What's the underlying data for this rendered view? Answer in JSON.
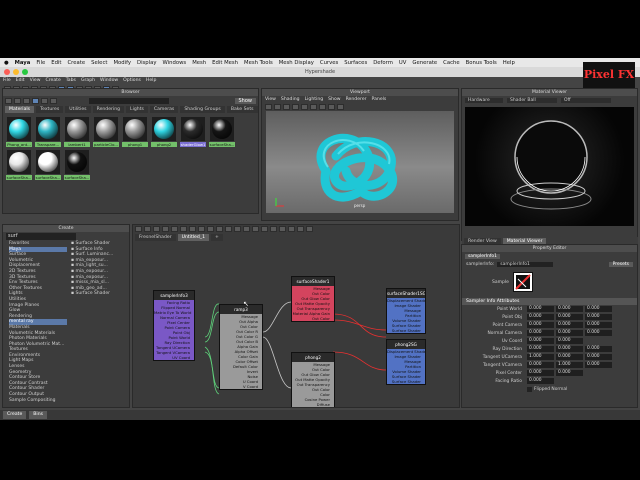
{
  "menubar": {
    "app_name": "Maya",
    "items": [
      "File",
      "Edit",
      "Create",
      "Select",
      "Modify",
      "Display",
      "Windows",
      "Mesh",
      "Edit Mesh",
      "Mesh Tools",
      "Mesh Display",
      "Curves",
      "Surfaces",
      "Deform",
      "UV",
      "Generate",
      "Cache",
      "Bonus Tools",
      "Help"
    ]
  },
  "window_title": "Hypershade",
  "hypershade_menu": [
    "File",
    "Edit",
    "View",
    "Create",
    "Tabs",
    "Graph",
    "Window",
    "Options",
    "Help"
  ],
  "browser": {
    "title": "Browser",
    "show_label": "Show",
    "tabs": [
      "Materials",
      "Textures",
      "Utilities",
      "Rendering",
      "Lights",
      "Cameras",
      "Shading Groups",
      "Bake Sets"
    ],
    "active_tab": "Materials",
    "swatches": [
      {
        "label": "Phong_ant...",
        "color": "#33d9e6"
      },
      {
        "label": "Transpare...",
        "color": "#2fb5c4"
      },
      {
        "label": "lambert1",
        "color": "#9b9b9b"
      },
      {
        "label": "particleClo...",
        "color": "#a0a0a0"
      },
      {
        "label": "phong1",
        "color": "#9a9a9a"
      },
      {
        "label": "phong2",
        "color": "#30d4e2"
      },
      {
        "label": "shaderGlow1",
        "color": "#2b2b2b",
        "selected": true
      },
      {
        "label": "surfaceSha...",
        "color": "#151515"
      },
      {
        "label": "surfaceSha...",
        "color": "#e8e8e8"
      },
      {
        "label": "surfaceSha...",
        "color": "#ffffff"
      },
      {
        "label": "surfaceSha...",
        "color": "#111111"
      }
    ]
  },
  "viewport": {
    "title": "Viewport",
    "menu": [
      "View",
      "Shading",
      "Lighting",
      "Show",
      "Renderer",
      "Panels"
    ],
    "camera_label": "persp"
  },
  "material_viewer": {
    "title": "Material Viewer",
    "dropdown1": "Hardware",
    "dropdown2": "Shader Ball",
    "dropdown3": "Off"
  },
  "create_panel": {
    "title": "Create",
    "search_value": "surf",
    "tree": [
      {
        "label": "Favorites"
      },
      {
        "label": "Maya",
        "hi": true
      },
      {
        "label": "Surface"
      },
      {
        "label": "Volumetric"
      },
      {
        "label": "Displacement"
      },
      {
        "label": "2D Textures"
      },
      {
        "label": "3D Textures"
      },
      {
        "label": "Env Textures"
      },
      {
        "label": "Other Textures"
      },
      {
        "label": "Lights"
      },
      {
        "label": "Utilities"
      },
      {
        "label": "Image Planes"
      },
      {
        "label": "Glow"
      },
      {
        "label": "Rendering"
      },
      {
        "label": "mental ray",
        "hi": true
      },
      {
        "label": "Materials"
      },
      {
        "label": "Volumetric Materials"
      },
      {
        "label": "Photon Materials"
      },
      {
        "label": "Photon Volumetric Mat..."
      },
      {
        "label": "Textures"
      },
      {
        "label": "Environments"
      },
      {
        "label": "Light Maps"
      },
      {
        "label": "Lenses"
      },
      {
        "label": "Geometry"
      },
      {
        "label": "Contour Store"
      },
      {
        "label": "Contour Contrast"
      },
      {
        "label": "Contour Shader"
      },
      {
        "label": "Contour Output"
      },
      {
        "label": "Sample Compositing"
      }
    ],
    "results": [
      "Surface Shader",
      "Surface Info",
      "Surf. Luminanc...",
      "mia_exposur...",
      "mia_light_su...",
      "mia_exposur...",
      "mia_exposur...",
      "misss_mia_sl...",
      "mib_geo_ad...",
      "Surface Shader"
    ]
  },
  "graph": {
    "tabs": [
      "FresnelShader",
      "Untitled_1",
      "+"
    ],
    "active_tab": "Untitled_1",
    "nodes": [
      {
        "name": "samplerInfo3",
        "color": "#7a58c6",
        "attrs": [
          "Facing Ratio",
          "Flipped Normal",
          "Matrix Eye To World",
          "Normal Camera",
          "Pixel Center",
          "Point Camera",
          "Point Obj",
          "Point World",
          "Ray Direction",
          "Tangent UCamera",
          "Tangent VCamera",
          "UV Coord"
        ]
      },
      {
        "name": "ramp3",
        "color": "#9a9a9a",
        "attrs": [
          "Message",
          "Out Alpha",
          "Out Color",
          "Out Color R",
          "Out Color G",
          "Out Color B",
          "Alpha Gain",
          "Alpha Offset",
          "Color Gain",
          "Color Offset",
          "Default Color",
          "Invert",
          "Noise",
          "U Coord",
          "V Coord"
        ]
      },
      {
        "name": "surfaceShader1",
        "color": "#d4445e",
        "attrs": [
          "Message",
          "Out Color",
          "Out Glow Color",
          "Out Matte Opacity",
          "Out Transparency",
          "Material Alpha Gain",
          "Out Color"
        ]
      },
      {
        "name": "phong2",
        "color": "#9a9a9a",
        "attrs": [
          "Message",
          "Out Color",
          "Out Glow Color",
          "Out Matte Opacity",
          "Out Transparency",
          "Out Color",
          "Color",
          "Cosine Power",
          "Diffuse",
          "Glow Intensity",
          "Incandescence",
          "Light Absorbance",
          "Material Alpha Gain"
        ]
      },
      {
        "name": "surfaceShader1SG",
        "color": "#5272c4",
        "attrs": [
          "Displacement Shader",
          "Image Shader",
          "Message",
          "Partition",
          "Volume Shader",
          "Surface Shader",
          "Surface Shader"
        ]
      },
      {
        "name": "phong2SG",
        "color": "#5272c4",
        "attrs": [
          "Displacement Shader",
          "Image Shader",
          "Message",
          "Partition",
          "Volume Shader",
          "Surface Shader",
          "Surface Shader"
        ]
      }
    ]
  },
  "property_editor": {
    "title": "Property Editor",
    "node_tab": "samplerInfo1",
    "type_label": "samplerInfo:",
    "name_value": "samplerInfo1",
    "presets_label": "Presets",
    "sample_label": "Sample",
    "section_title": "Sampler Info Attributes",
    "rows": [
      {
        "label": "Point World",
        "v": [
          "0.000",
          "0.000",
          "0.000"
        ]
      },
      {
        "label": "Point Obj",
        "v": [
          "0.000",
          "0.000",
          "0.000"
        ]
      },
      {
        "label": "Point Camera",
        "v": [
          "0.000",
          "0.000",
          "0.000"
        ]
      },
      {
        "label": "Normal Camera",
        "v": [
          "0.000",
          "0.000",
          "0.000"
        ]
      },
      {
        "label": "Uv Coord",
        "v": [
          "0.000",
          "0.000",
          ""
        ]
      },
      {
        "label": "Ray Direction",
        "v": [
          "0.000",
          "0.000",
          "0.000"
        ]
      },
      {
        "label": "Tangent UCamera",
        "v": [
          "1.000",
          "0.000",
          "0.000"
        ]
      },
      {
        "label": "Tangent VCamera",
        "v": [
          "0.000",
          "1.000",
          "0.000"
        ]
      },
      {
        "label": "Pixel Center",
        "v": [
          "0.000",
          "0.000",
          ""
        ]
      },
      {
        "label": "Facing Ratio",
        "v": [
          "0.000",
          "",
          ""
        ]
      }
    ],
    "flipped_normal_label": "Flipped Normal"
  },
  "render_tabs": [
    "Render View",
    "Material Viewer"
  ],
  "bottom_tabs": [
    "Create",
    "Bins"
  ],
  "watermark": "Pixel FX"
}
